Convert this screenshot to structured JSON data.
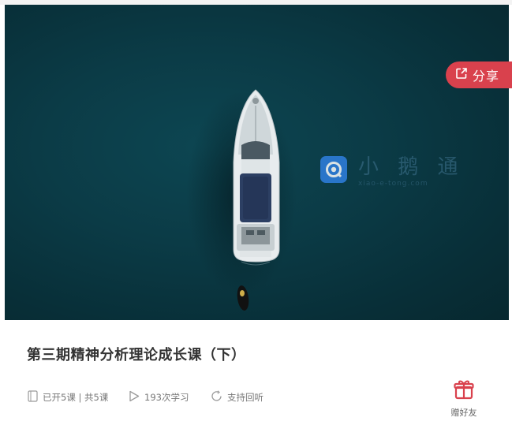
{
  "banner": {
    "share_label": "分享",
    "watermark": {
      "cn": "小 鹅 通",
      "en": "xiao-e-tong.com"
    }
  },
  "course": {
    "title": "第三期精神分析理论成长课（下）",
    "lessons": "已开5课 | 共5课",
    "learners": "193次学习",
    "replay": "支持回听"
  },
  "gift": {
    "label": "赠好友"
  },
  "colors": {
    "accent": "#d9414d",
    "sea": "#0b3b46"
  },
  "icons": [
    "share-icon",
    "book-icon",
    "play-icon",
    "replay-icon",
    "gift-icon"
  ]
}
